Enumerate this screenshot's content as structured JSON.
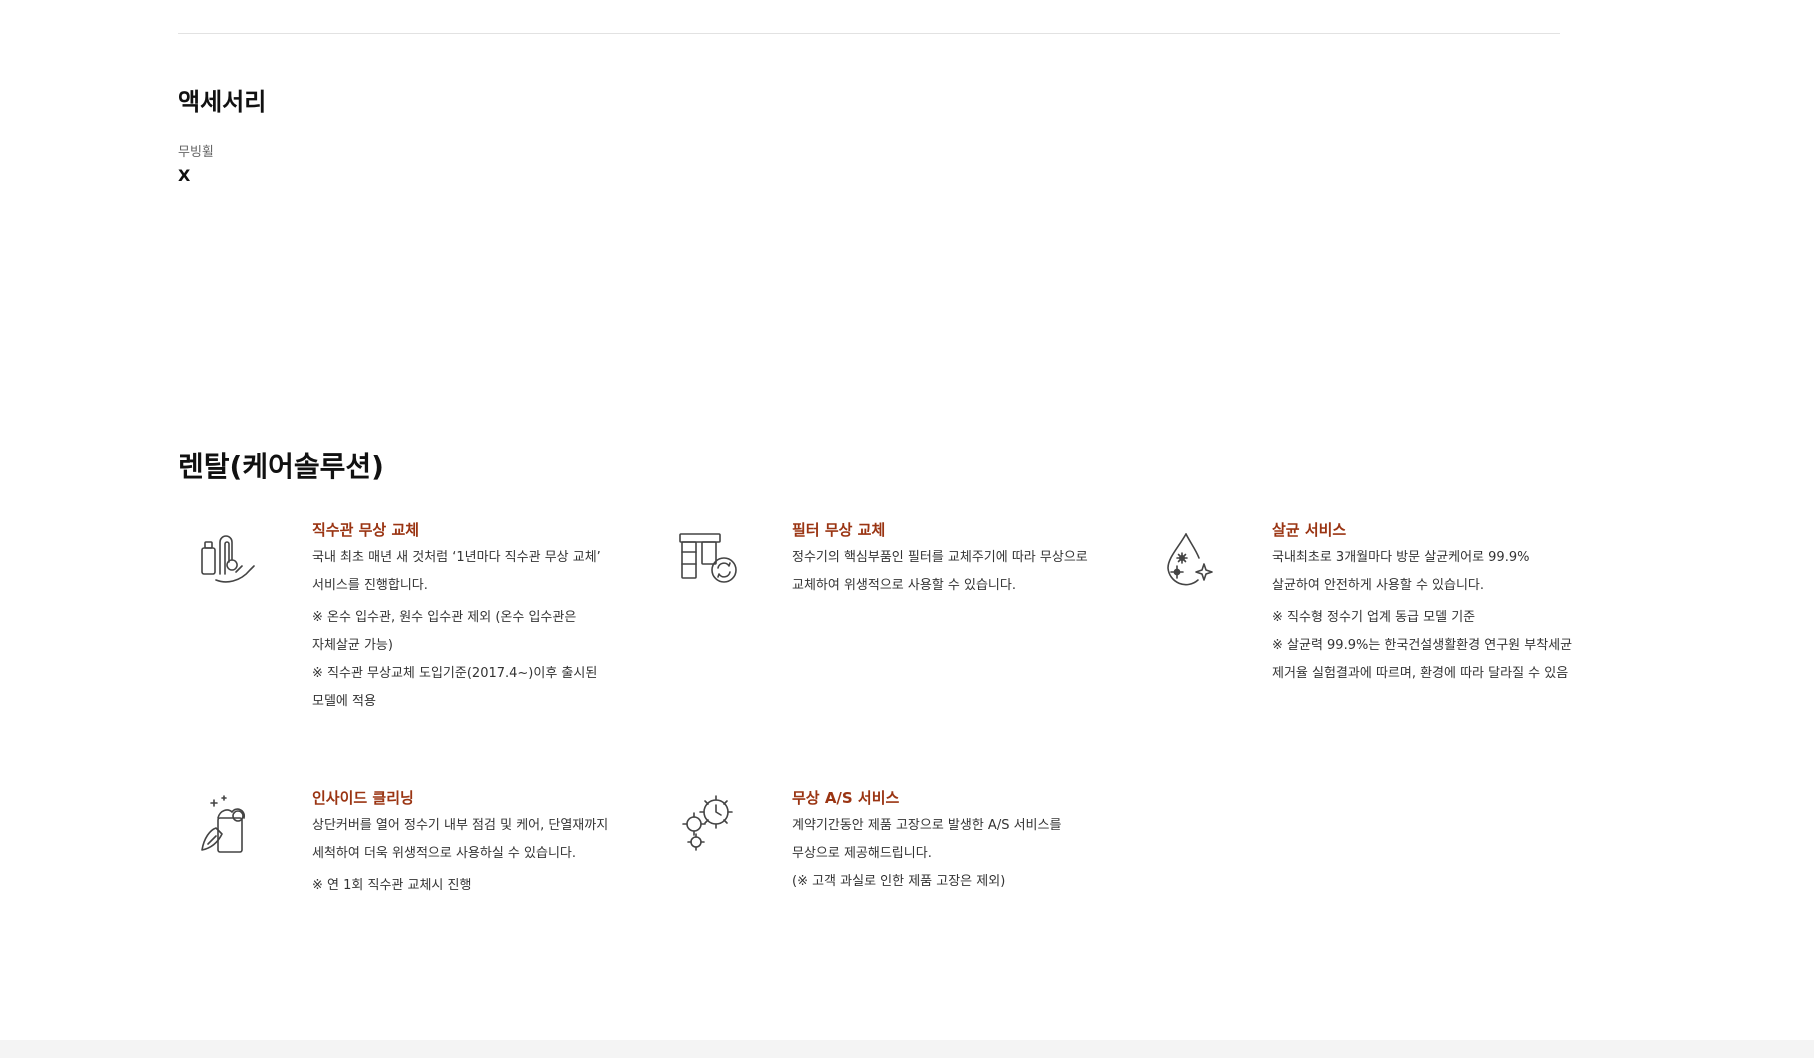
{
  "accessory": {
    "title": "액세서리",
    "items": [
      {
        "label": "무빙휠",
        "value": "X"
      }
    ]
  },
  "rental": {
    "title": "렌탈(케어솔루션)",
    "services": [
      {
        "icon": "pipe-replacement-icon",
        "title": "직수관 무상 교체",
        "desc": [
          "국내 최초 매년 새 것처럼 ‘1년마다 직수관 무상 교체’",
          "서비스를 진행합니다."
        ],
        "notes": [
          "※ 온수 입수관, 원수 입수관 제외 (온수 입수관은",
          "자체살균 가능)",
          "※ 직수관 무상교체 도입기준(2017.4~)이후 출시된",
          "모델에 적용"
        ]
      },
      {
        "icon": "filter-replacement-icon",
        "title": "필터 무상 교체",
        "desc": [
          "정수기의 핵심부품인 필터를 교체주기에 따라 무상으로",
          "교체하여 위생적으로 사용할 수 있습니다."
        ],
        "notes": []
      },
      {
        "icon": "sterilization-drop-icon",
        "title": "살균 서비스",
        "desc": [
          "국내최초로 3개월마다 방문 살균케어로 99.9%",
          "살균하여 안전하게 사용할 수 있습니다."
        ],
        "notes": [
          "※ 직수형 정수기 업계 동급 모델 기준",
          "※ 살균력 99.9%는 한국건설생활환경 연구원 부착세균",
          "제거율 실험결과에 따르며, 환경에 따라 달라질 수 있음"
        ]
      },
      {
        "icon": "inside-cleaning-icon",
        "title": "인사이드 클리닝",
        "desc": [
          "상단커버를 열어 정수기 내부 점검 및 케어, 단열재까지",
          "세척하여 더욱 위생적으로 사용하실 수 있습니다."
        ],
        "notes": [
          "※ 연 1회 직수관 교체시 진행"
        ]
      },
      {
        "icon": "gear-clock-icon",
        "title": "무상 A/S 서비스",
        "desc": [
          "계약기간동안 제품 고장으로 발생한 A/S 서비스를",
          "무상으로 제공해드립니다.",
          "(※ 고객 과실로 인한 제품 고장은 제외)"
        ],
        "notes": []
      }
    ]
  },
  "colors": {
    "accent": "#9a3412",
    "text": "#333333",
    "divider": "#e2e2e2"
  }
}
